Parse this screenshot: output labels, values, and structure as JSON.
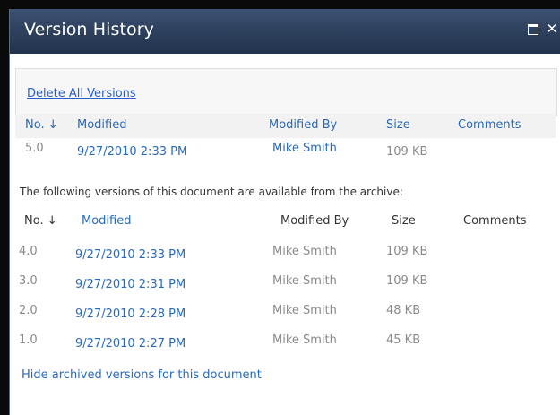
{
  "dialog": {
    "title": "Version History",
    "maximize_icon": "maximize-icon",
    "close_icon": "close-icon",
    "close_glyph": "✕"
  },
  "toolbar": {
    "delete_all": "Delete All Versions"
  },
  "columns": {
    "no": "No. ↓",
    "modified": "Modified",
    "modified_by": "Modified By",
    "size": "Size",
    "comments": "Comments"
  },
  "current_version": {
    "no": "5.0",
    "modified": "9/27/2010 2:33 PM",
    "modified_by": "Mike Smith",
    "size": "109 KB"
  },
  "archive_message": "The following versions of this document are available from the archive:",
  "archived_versions": [
    {
      "no": "4.0",
      "modified": "9/27/2010 2:33 PM",
      "modified_by": "Mike Smith",
      "size": "109 KB"
    },
    {
      "no": "3.0",
      "modified": "9/27/2010 2:31 PM",
      "modified_by": "Mike Smith",
      "size": "109 KB"
    },
    {
      "no": "2.0",
      "modified": "9/27/2010 2:28 PM",
      "modified_by": "Mike Smith",
      "size": "48 KB"
    },
    {
      "no": "1.0",
      "modified": "9/27/2010 2:27 PM",
      "modified_by": "Mike Smith",
      "size": "45 KB"
    }
  ],
  "hide_link": "Hide archived versions for this document",
  "colors": {
    "titlebar": "#2a3d59",
    "link": "#2a6ab8",
    "muted": "#8a8a8a"
  }
}
